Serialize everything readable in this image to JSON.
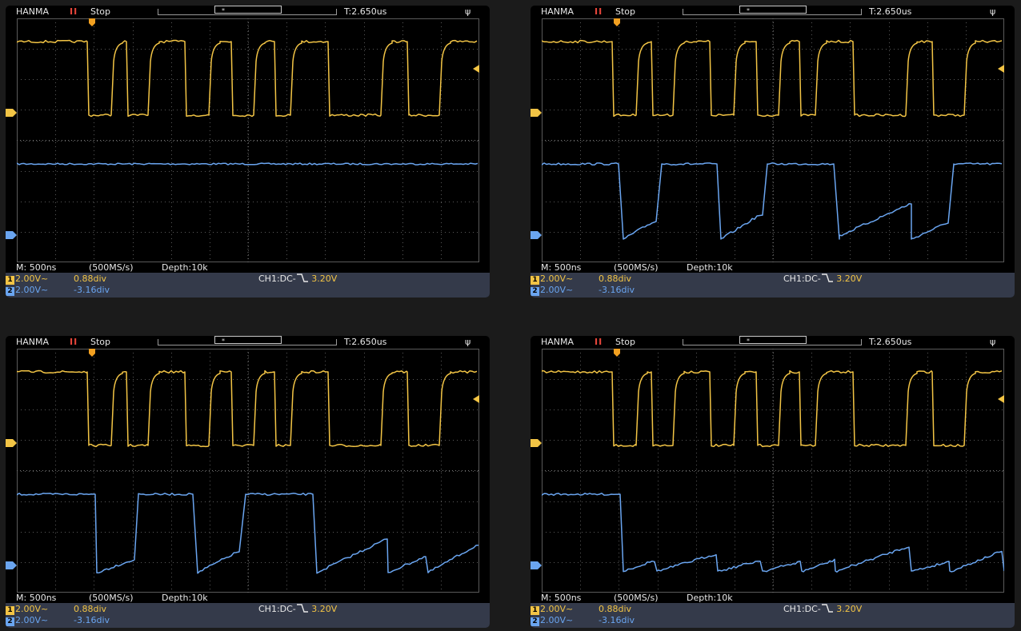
{
  "colors": {
    "ch1": "#f2c445",
    "ch2": "#6aa5f0",
    "grid": "#5a5a5a",
    "status_bar": "#343a4a",
    "stop": "#e6453a"
  },
  "icons": {
    "usb": "usb-icon",
    "trigger": "trigger-marker-icon",
    "ch1_level": "ch1-level-marker",
    "ch2_level": "ch2-level-marker"
  },
  "screens": [
    {
      "header": {
        "brand": "HANMA",
        "pause_icon": "II",
        "state": "Stop",
        "window_marker": "*",
        "trigger_time": "T:2.650us",
        "usb_icon": "ψ"
      },
      "status": {
        "timebase": "M: 500ns",
        "sample_rate": "(500MS/s)",
        "depth": "Depth:10k",
        "ch1_num": "1",
        "ch1_scale": "2.00V~",
        "ch1_offset": "0.88div",
        "ch2_num": "2",
        "ch2_scale": "2.00V~",
        "ch2_offset": "-3.16div",
        "trigger_info": "CH1:DC-",
        "trigger_level": "3.20V"
      },
      "ch2_pattern": "flat"
    },
    {
      "header": {
        "brand": "HANMA",
        "pause_icon": "II",
        "state": "Stop",
        "window_marker": "*",
        "trigger_time": "T:2.650us",
        "usb_icon": "ψ"
      },
      "status": {
        "timebase": "M: 500ns",
        "sample_rate": "(500MS/s)",
        "depth": "Depth:10k",
        "ch1_num": "1",
        "ch1_scale": "2.00V~",
        "ch1_offset": "0.88div",
        "ch2_num": "2",
        "ch2_scale": "2.00V~",
        "ch2_offset": "-3.16div",
        "trigger_info": "CH1:DC-",
        "trigger_level": "3.20V"
      },
      "ch2_pattern": "pulses"
    },
    {
      "header": {
        "brand": "HANMA",
        "pause_icon": "II",
        "state": "Stop",
        "window_marker": "*",
        "trigger_time": "T:2.650us",
        "usb_icon": "ψ"
      },
      "status": {
        "timebase": "M: 500ns",
        "sample_rate": "(500MS/s)",
        "depth": "Depth:10k",
        "ch1_num": "1",
        "ch1_scale": "2.00V~",
        "ch1_offset": "0.88div",
        "ch2_num": "2",
        "ch2_scale": "2.00V~",
        "ch2_offset": "-3.16div",
        "trigger_info": "CH1:DC-",
        "trigger_level": "3.20V"
      },
      "ch2_pattern": "mixed"
    },
    {
      "header": {
        "brand": "HANMA",
        "pause_icon": "II",
        "state": "Stop",
        "window_marker": "*",
        "trigger_time": "T:2.650us",
        "usb_icon": "ψ"
      },
      "status": {
        "timebase": "M: 500ns",
        "sample_rate": "(500MS/s)",
        "depth": "Depth:10k",
        "ch1_num": "1",
        "ch1_scale": "2.00V~",
        "ch1_offset": "0.88div",
        "ch2_num": "2",
        "ch2_scale": "2.00V~",
        "ch2_offset": "-3.16div",
        "trigger_info": "CH1:DC-",
        "trigger_level": "3.20V"
      },
      "ch2_pattern": "sawtooth"
    }
  ]
}
